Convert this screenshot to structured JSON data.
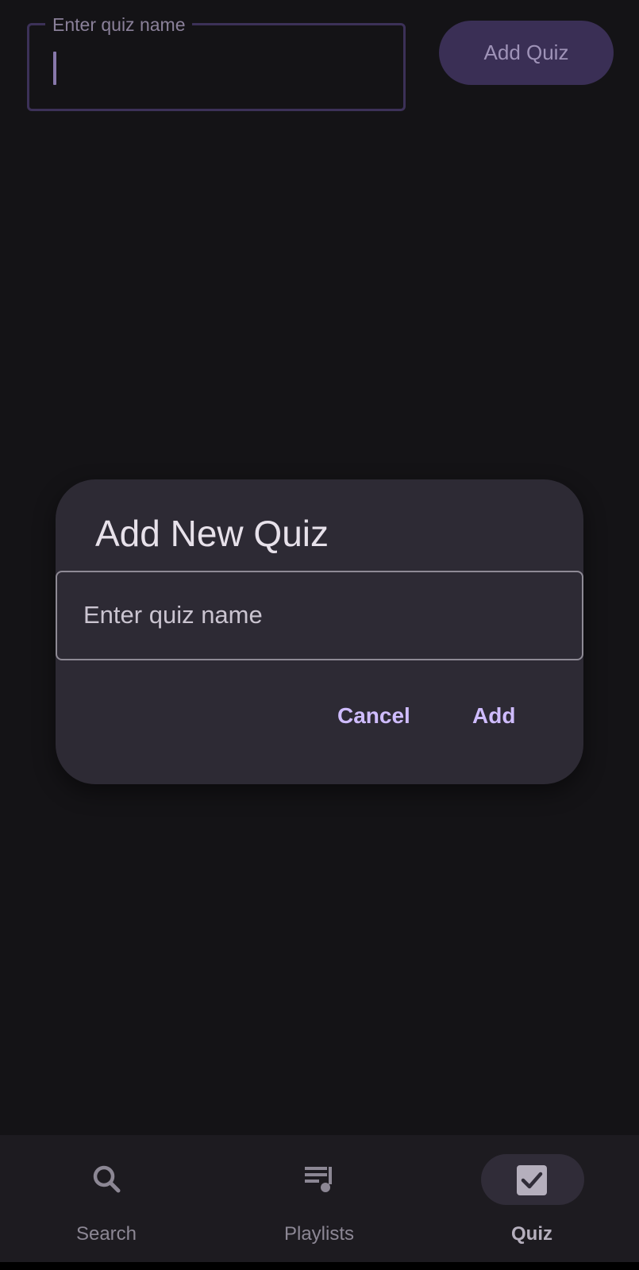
{
  "top_bar": {
    "quiz_name_label": "Enter quiz name",
    "add_quiz_button": "Add Quiz"
  },
  "dialog": {
    "title": "Add New Quiz",
    "input_placeholder": "Enter quiz name",
    "cancel_label": "Cancel",
    "add_label": "Add"
  },
  "bottom_nav": {
    "items": [
      {
        "label": "Search",
        "icon": "search-icon",
        "active": false
      },
      {
        "label": "Playlists",
        "icon": "playlist-icon",
        "active": false
      },
      {
        "label": "Quiz",
        "icon": "checkbox-icon",
        "active": true
      }
    ]
  },
  "colors": {
    "background": "#141316",
    "dialog_surface": "#2d2a34",
    "accent": "#cfbcff",
    "nav_surface": "#1d1b20"
  }
}
